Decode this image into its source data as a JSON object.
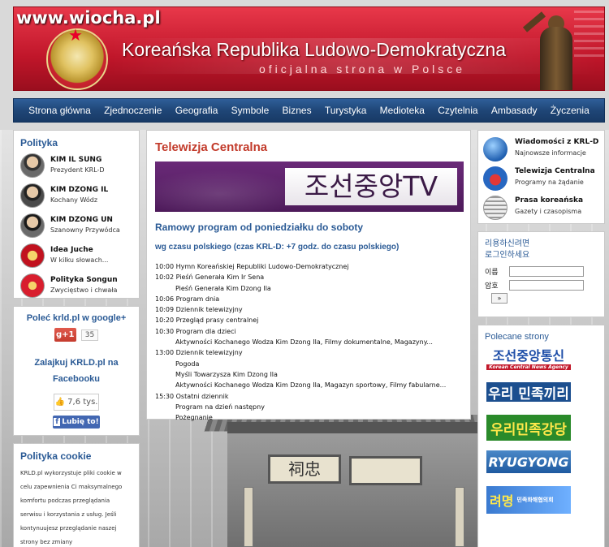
{
  "header": {
    "watermark": "www.wiocha.pl",
    "title": "Koreańska Republika Ludowo-Demokratyczna",
    "subtitle": "oficjalna strona w Polsce"
  },
  "nav": [
    "Strona główna",
    "Zjednoczenie",
    "Geografia",
    "Symbole",
    "Biznes",
    "Turystyka",
    "Medioteka",
    "Czytelnia",
    "Ambasady",
    "Życzenia"
  ],
  "politics": {
    "title": "Polityka",
    "items": [
      {
        "name": "KIM IL SUNG",
        "sub": "Prezydent KRL-D",
        "icon": "kim-il-sung-portrait-icon"
      },
      {
        "name": "KIM DZONG IL",
        "sub": "Kochany Wódz",
        "icon": "kim-dzong-il-portrait-icon"
      },
      {
        "name": "KIM DZONG UN",
        "sub": "Szanowny Przywódca",
        "icon": "kim-dzong-un-portrait-icon"
      },
      {
        "name": "Idea Juche",
        "sub": "W kilku słowach...",
        "icon": "juche-emblem-icon"
      },
      {
        "name": "Polityka Songun",
        "sub": "Zwycięstwo i chwała",
        "icon": "songun-emblem-icon"
      }
    ]
  },
  "google": {
    "title": "Poleć krld.pl w google+",
    "button": "g+1",
    "count": "35"
  },
  "facebook": {
    "title": "Zalajkuj KRLD.pl na Facebooku",
    "count": "7,6 tys.",
    "like": "Lubię to!"
  },
  "cookie": {
    "title": "Polityka cookie",
    "text": "KRLD.pl wykorzystuje pliki cookie w celu zapewnienia Ci maksymalnego komfortu podczas przeglądania serwisu i korzystania z usług. Jeśli kontynuujesz przeglądanie naszej strony bez zmiany"
  },
  "center": {
    "title": "Telewizja Centralna",
    "banner": "조선중앙TV",
    "program_title": "Ramowy program od poniedziałku do soboty",
    "program_sub": "wg czasu polskiego (czas KRL-D: +7 godz. do czasu polskiego)",
    "schedule": [
      {
        "text": "10:00 Hymn Koreańskiej Republiki Ludowo-Demokratycznej",
        "indent": false
      },
      {
        "text": "10:02 Pieśń Generała Kim Ir Sena",
        "indent": false
      },
      {
        "text": "Pieśń Generała Kim Dzong Ila",
        "indent": true
      },
      {
        "text": "10:06 Program dnia",
        "indent": false
      },
      {
        "text": "10:09 Dziennik telewizyjny",
        "indent": false
      },
      {
        "text": "10:20 Przegląd prasy centralnej",
        "indent": false
      },
      {
        "text": "10:30 Program dla dzieci",
        "indent": false
      },
      {
        "text": "Aktywności Kochanego Wodza Kim Dzong Ila, Filmy dokumentalne, Magazyny...",
        "indent": true
      },
      {
        "text": "13:00 Dziennik telewizyjny",
        "indent": false
      },
      {
        "text": "Pogoda",
        "indent": true
      },
      {
        "text": "Myśli Towarzysza Kim Dzong Ila",
        "indent": true
      },
      {
        "text": "Aktywności Kochanego Wodza Kim Dzong Ila, Magazyn sportowy, Filmy fabularne...",
        "indent": true
      },
      {
        "text": "15:30 Ostatni dziennik",
        "indent": false
      },
      {
        "text": "Program na dzień następny",
        "indent": true
      },
      {
        "text": "Pożegnanie",
        "indent": true
      }
    ]
  },
  "news": [
    {
      "name": "Wiadomości z KRL-D",
      "sub": "Najnowsze informacje",
      "icon": "globe-icon"
    },
    {
      "name": "Telewizja Centralna",
      "sub": "Programy na żądanie",
      "icon": "tv-icon"
    },
    {
      "name": "Prasa koreańska",
      "sub": "Gazety i czasopisma",
      "icon": "newspaper-icon"
    }
  ],
  "login": {
    "heading_line1": "리용하신려면",
    "heading_line2": "로그인하세요",
    "user_label": "이름",
    "pass_label": "암호",
    "submit": "»"
  },
  "recommended": {
    "title": "Polecane strony",
    "logos": [
      {
        "text": "조선중앙통신",
        "sub": "Korean Central News Agency",
        "bg": "#ffffff",
        "color": "#1e4ea8"
      },
      {
        "text": "우리 민족끼리",
        "sub": "",
        "bg": "#1c4f8f",
        "color": "#ffffff"
      },
      {
        "text": "우리민족강당",
        "sub": "",
        "bg": "#2a8a2a",
        "color": "#ffe84a"
      },
      {
        "text": "RYUGYONG",
        "sub": "",
        "bg": "#2a66a8",
        "color": "#ffffff"
      },
      {
        "text": "려명",
        "sub": "민족화해협의회",
        "bg": "#3a7ad0",
        "color": "#ffe84a"
      }
    ]
  },
  "colors": {
    "header_red": "#c0162a",
    "nav_blue": "#1f4677",
    "link_blue": "#2a5a95",
    "title_red": "#c23a2a"
  }
}
